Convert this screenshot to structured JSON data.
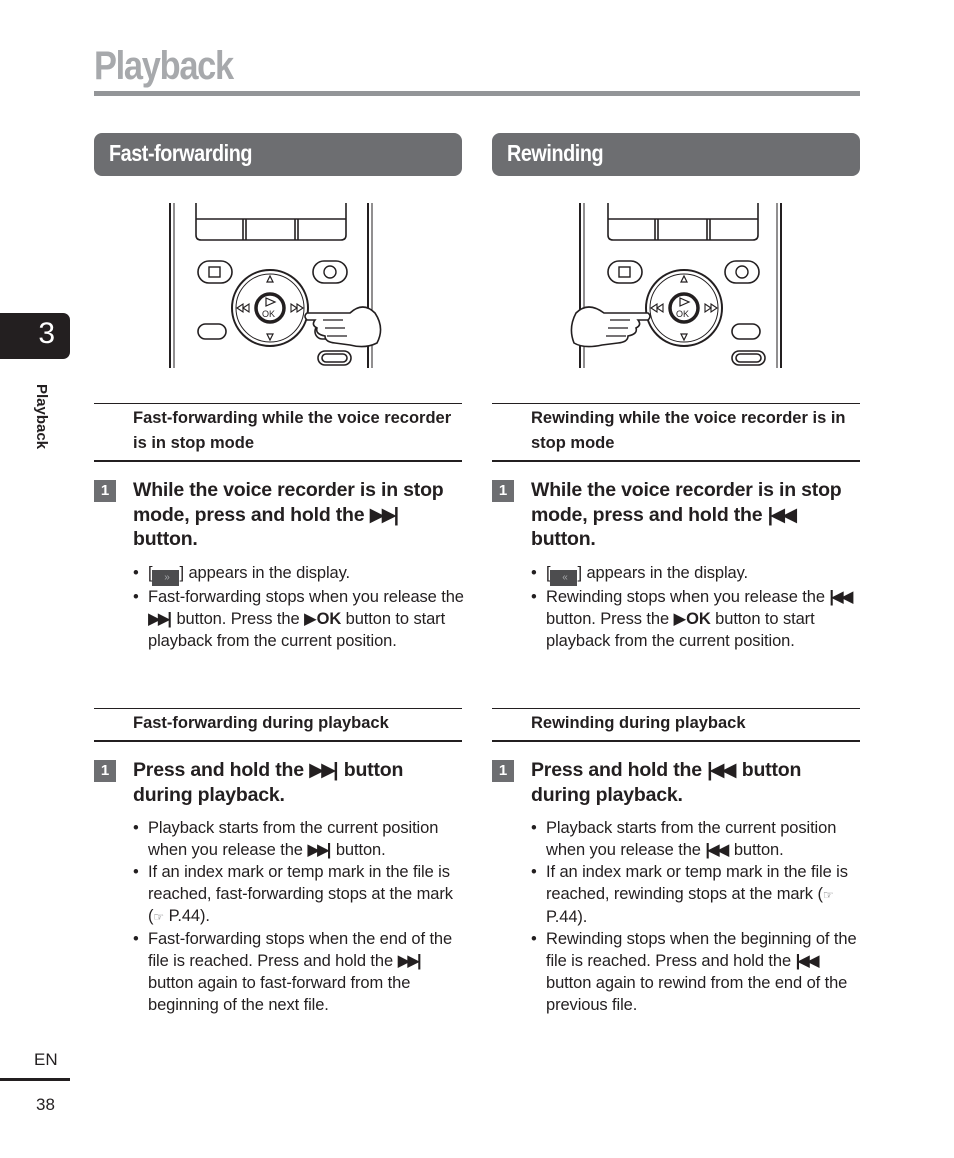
{
  "page": {
    "title": "Playback",
    "chapter_number": "3",
    "side_label": "Playback",
    "language": "EN",
    "page_number": "38"
  },
  "icons": {
    "ff_button": "▶▶|",
    "rw_button": "|◀◀",
    "play_triangle": "▶",
    "ok_label": "OK",
    "ff_display": "»",
    "rw_display": "«",
    "reference": "☞"
  },
  "fast_forwarding": {
    "header": "Fast-forwarding",
    "stop_mode": {
      "subhead": "Fast-forwarding while the voice recorder is in stop mode",
      "step_number": "1",
      "step_text_a": "While the voice recorder is in stop mode, press and hold the",
      "step_text_b": "button.",
      "bullet1_a": "[",
      "bullet1_b": "] appears in the display.",
      "bullet2_a": "Fast-forwarding stops when you release the",
      "bullet2_b": "button. Press the",
      "bullet2_c": "button to start playback from the current position."
    },
    "during_playback": {
      "subhead": "Fast-forwarding during playback",
      "step_number": "1",
      "step_text_a": "Press and hold the",
      "step_text_b": "button during playback.",
      "bullet1_a": "Playback starts from the current position when you release the",
      "bullet1_b": "button.",
      "bullet2_a": "If an index mark or temp mark in the file is reached, fast-forwarding stops at the mark (",
      "bullet2_b": "P.44).",
      "bullet3_a": "Fast-forwarding stops when the end of the file is reached. Press and hold the",
      "bullet3_b": "button again to fast-forward from the beginning of the next file."
    }
  },
  "rewinding": {
    "header": "Rewinding",
    "stop_mode": {
      "subhead": "Rewinding while the voice recorder is in stop mode",
      "step_number": "1",
      "step_text_a": "While the voice recorder is in stop mode, press and hold the",
      "step_text_b": "button.",
      "bullet1_a": "[",
      "bullet1_b": "] appears in the display.",
      "bullet2_a": "Rewinding stops when you release the",
      "bullet2_b": "button. Press the",
      "bullet2_c": "button to start playback from the current position."
    },
    "during_playback": {
      "subhead": "Rewinding during playback",
      "step_number": "1",
      "step_text_a": "Press and hold the",
      "step_text_b": "button during playback.",
      "bullet1_a": "Playback starts from the current position when you release the",
      "bullet1_b": "button.",
      "bullet2_a": "If an index mark or temp mark in the file is reached, rewinding stops at the mark (",
      "bullet2_b": "P.44).",
      "bullet3_a": "Rewinding stops when the beginning of the file is reached. Press and hold the",
      "bullet3_b": "button again to rewind from the end of the previous file."
    }
  }
}
